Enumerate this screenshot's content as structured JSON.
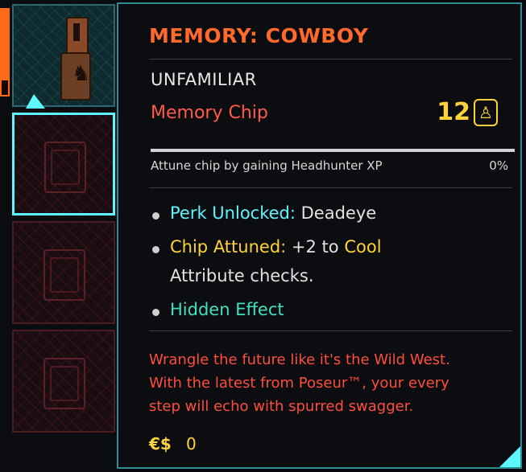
{
  "item": {
    "name": "MEMORY: COWBOY",
    "rarity": "UNFAMILIAR",
    "type": "Memory Chip",
    "level": "12",
    "attune_text": "Attune chip by gaining Headhunter XP",
    "attune_percent": "0%",
    "attune_progress": 0.0
  },
  "effects": {
    "perk_label": "Perk Unlocked:",
    "perk_value": "Deadeye",
    "chip_label": "Chip Attuned:",
    "chip_value_pre": "+2 to",
    "chip_value_attr": "Cool",
    "chip_value_post": "Attribute checks.",
    "hidden": "Hidden Effect"
  },
  "lore": [
    "Wrangle the future like it's the Wild West.",
    "With the latest from Poseur™, your every",
    "step will echo with spurred swagger."
  ],
  "price": {
    "symbol": "€$",
    "value": "0"
  },
  "colors": {
    "title": "#ff6a2c",
    "accent_cyan": "#5ef6ff",
    "accent_yellow": "#ffd23a",
    "lore_red": "#ff4d3d"
  },
  "icons": {
    "level": "person-icon",
    "slot_empty": "chip-slot-icon"
  }
}
